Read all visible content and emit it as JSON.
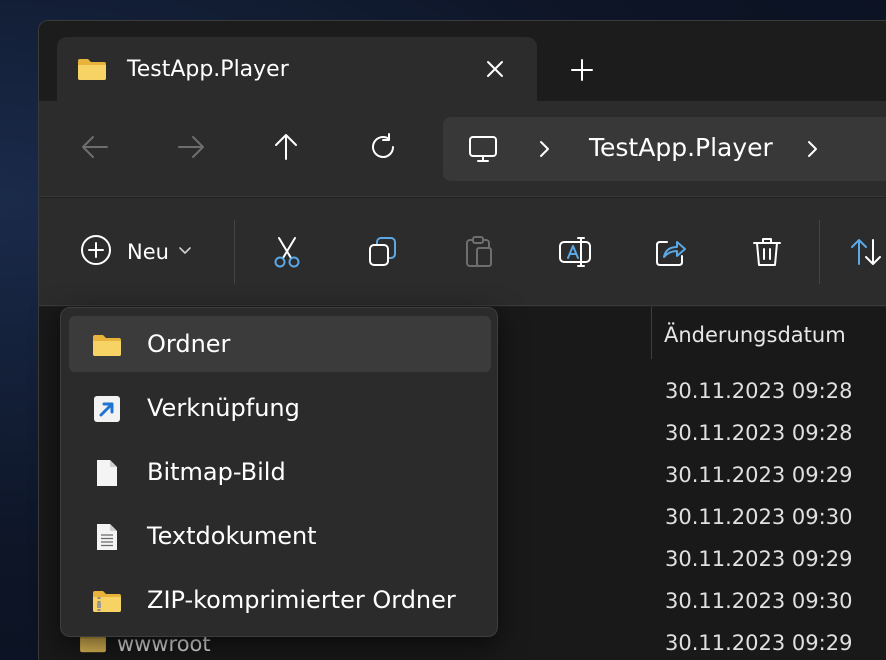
{
  "tab": {
    "title": "TestApp.Player"
  },
  "address": {
    "crumb": "TestApp.Player"
  },
  "toolbar": {
    "new_label": "Neu"
  },
  "list": {
    "column_header": "Änderungsdatum",
    "dates": [
      "30.11.2023 09:28",
      "30.11.2023 09:28",
      "30.11.2023 09:29",
      "30.11.2023 09:30",
      "30.11.2023 09:29",
      "30.11.2023 09:30",
      "30.11.2023 09:29"
    ],
    "visible_item": "wwwroot"
  },
  "new_menu": {
    "items": [
      {
        "label": "Ordner",
        "icon": "folder-icon"
      },
      {
        "label": "Verknüpfung",
        "icon": "shortcut-icon"
      },
      {
        "label": "Bitmap-Bild",
        "icon": "blank-file-icon"
      },
      {
        "label": "Textdokument",
        "icon": "text-file-icon"
      },
      {
        "label": "ZIP-komprimierter Ordner",
        "icon": "zip-folder-icon"
      }
    ]
  },
  "colors": {
    "accent": "#5aa8e6",
    "folder": "#f3c94b"
  }
}
